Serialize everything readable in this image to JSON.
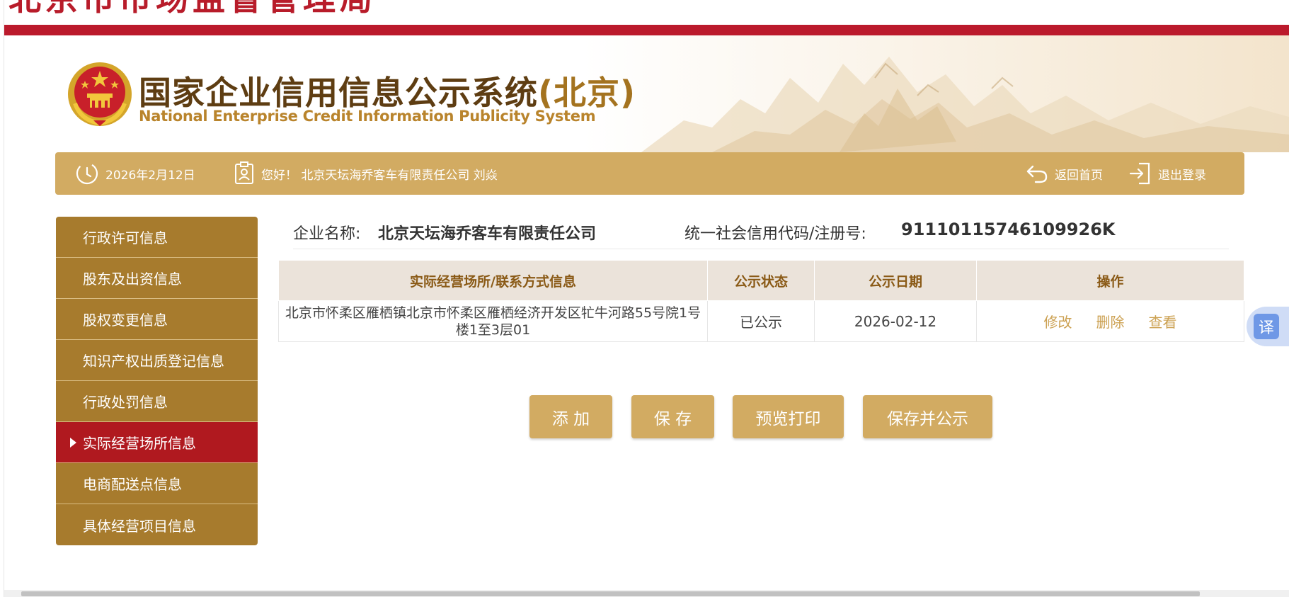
{
  "header": {
    "top_clip_text": "北京市市场监督管理局",
    "title_cn": "国家企业信用信息公示系统",
    "title_region": "(北京)",
    "title_en": "National Enterprise Credit Information Publicity System"
  },
  "infobar": {
    "date": "2026年2月12日",
    "greeting": "您好！ 北京天坛海乔客车有限责任公司  刘焱",
    "home_link": "返回首页",
    "logout_link": "退出登录"
  },
  "sidebar": {
    "items": [
      {
        "label": "行政许可信息",
        "active": false
      },
      {
        "label": "股东及出资信息",
        "active": false
      },
      {
        "label": "股权变更信息",
        "active": false
      },
      {
        "label": "知识产权出质登记信息",
        "active": false
      },
      {
        "label": "行政处罚信息",
        "active": false
      },
      {
        "label": "实际经营场所信息",
        "active": true
      },
      {
        "label": "电商配送点信息",
        "active": false
      },
      {
        "label": "具体经营项目信息",
        "active": false
      }
    ]
  },
  "company": {
    "name_label": "企业名称:",
    "name": "北京天坛海乔客车有限责任公司",
    "code_label": "统一社会信用代码/注册号:",
    "code": "91110115746109926K"
  },
  "table": {
    "headers": [
      "实际经营场所/联系方式信息",
      "公示状态",
      "公示日期",
      "操作"
    ],
    "rows": [
      {
        "address": "北京市怀柔区雁栖镇北京市怀柔区雁栖经济开发区牤牛河路55号院1号楼1至3层01",
        "status": "已公示",
        "date": "2026-02-12",
        "actions": [
          "修改",
          "删除",
          "查看"
        ]
      }
    ]
  },
  "buttons": {
    "add": "添 加",
    "save": "保 存",
    "preview": "预览打印",
    "save_publish": "保存并公示"
  },
  "translate_widget": {
    "glyph": "译"
  },
  "colors": {
    "header_red": "#bb1a2c",
    "gold": "#d2ab62",
    "sidebar_brown": "#a77b2d",
    "active_red": "#b0191f",
    "action_link": "#cca152"
  },
  "icons": [
    "clock-icon",
    "user-badge-icon",
    "return-icon",
    "logout-icon",
    "national-emblem-icon",
    "translate-icon"
  ]
}
